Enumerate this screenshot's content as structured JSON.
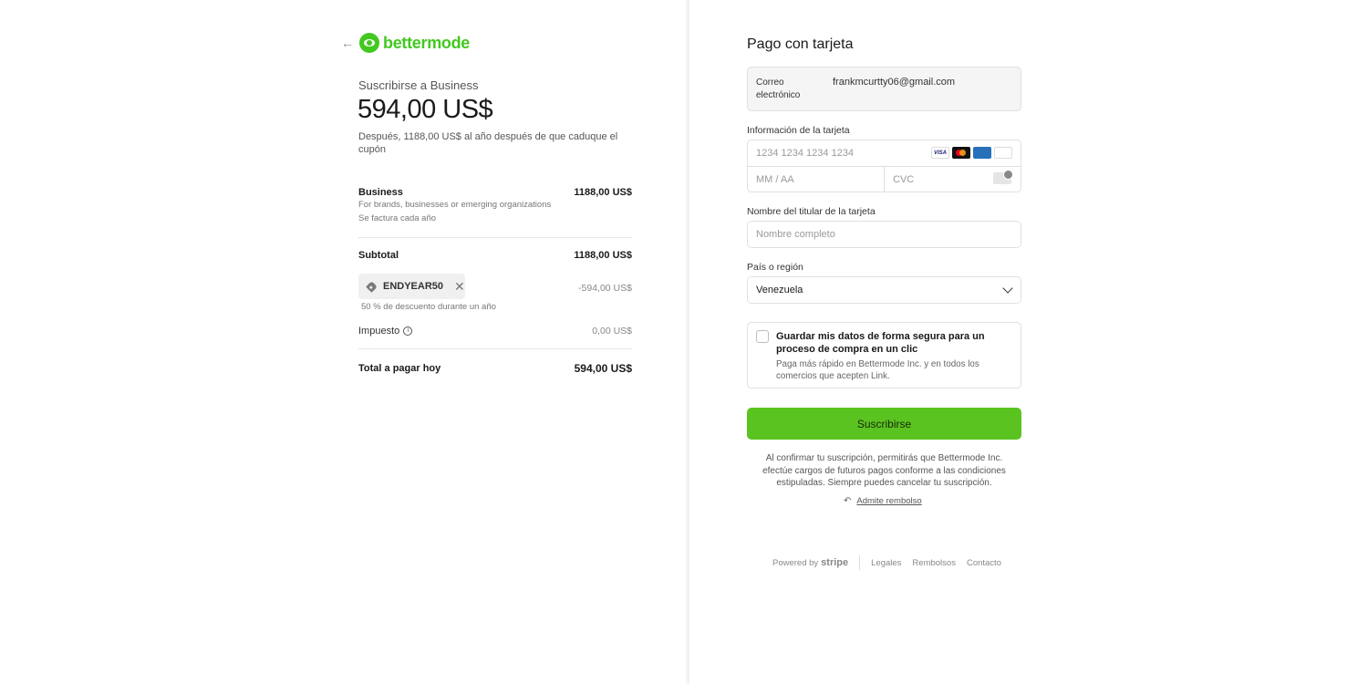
{
  "brand": {
    "name": "bettermode",
    "accent": "#42c81f"
  },
  "summary": {
    "subscribe_label": "Suscribirse a Business",
    "price": "594,00 US$",
    "price_note": "Después, 1188,00 US$ al año después de que caduque el cupón"
  },
  "line_item": {
    "name": "Business",
    "description": "For brands, businesses or emerging organizations",
    "billing": "Se factura cada año",
    "amount": "1188,00 US$"
  },
  "subtotal": {
    "label": "Subtotal",
    "amount": "1188,00 US$"
  },
  "coupon": {
    "code": "ENDYEAR50",
    "amount": "-594,00 US$",
    "description": "50 % de descuento durante un año"
  },
  "tax": {
    "label": "Impuesto",
    "amount": "0,00 US$"
  },
  "total": {
    "label": "Total a pagar hoy",
    "amount": "594,00 US$"
  },
  "payment": {
    "title": "Pago con tarjeta",
    "email_label": "Correo electrónico",
    "email_value": "frankmcurtty06@gmail.com",
    "card_info_label": "Información de la tarjeta",
    "card_number_placeholder": "1234 1234 1234 1234",
    "expiry_placeholder": "MM / AA",
    "cvc_placeholder": "CVC",
    "card_brands": [
      "VISA",
      "mastercard",
      "AMEX",
      "DISCOVER"
    ],
    "cardholder_label": "Nombre del titular de la tarjeta",
    "cardholder_placeholder": "Nombre completo",
    "country_label": "País o región",
    "country_value": "Venezuela",
    "save_title": "Guardar mis datos de forma segura para un proceso de compra en un clic",
    "save_desc": "Paga más rápido en Bettermode Inc. y en todos los comercios que acepten Link.",
    "subscribe_button": "Suscribirse",
    "button_color": "#5ac31f",
    "legal": "Al confirmar tu suscripción, permitirás que Bettermode Inc. efectúe cargos de futuros pagos conforme a las condiciones estipuladas. Siempre puedes cancelar tu suscripción.",
    "refund_link": "Admite rembolso"
  },
  "footer": {
    "powered_by": "Powered by",
    "stripe": "stripe",
    "links": [
      "Legales",
      "Rembolsos",
      "Contacto"
    ]
  }
}
